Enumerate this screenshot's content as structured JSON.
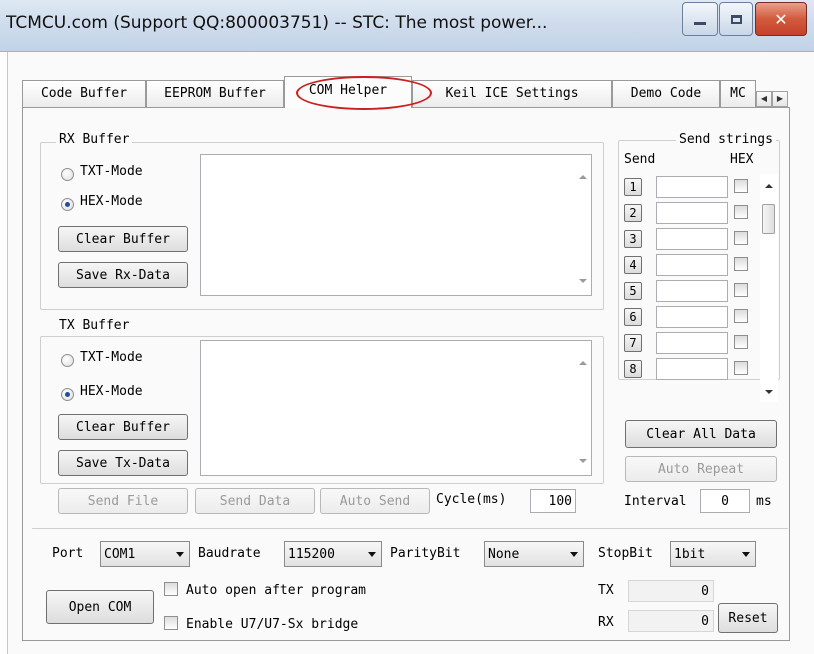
{
  "window": {
    "title": "TCMCU.com  (Support QQ:800003751)  -- STC: The most power..."
  },
  "tabs": [
    {
      "label": "Code Buffer"
    },
    {
      "label": "EEPROM Buffer"
    },
    {
      "label": "COM Helper",
      "active": true
    },
    {
      "label": "Keil ICE Settings"
    },
    {
      "label": "Demo Code"
    },
    {
      "label": "MC"
    }
  ],
  "rx": {
    "group_label": "RX Buffer",
    "txt_mode": "TXT-Mode",
    "hex_mode": "HEX-Mode",
    "selected_mode": "HEX-Mode",
    "clear_button": "Clear Buffer",
    "save_button": "Save Rx-Data",
    "content": ""
  },
  "tx": {
    "group_label": "TX Buffer",
    "txt_mode": "TXT-Mode",
    "hex_mode": "HEX-Mode",
    "selected_mode": "HEX-Mode",
    "clear_button": "Clear Buffer",
    "save_button": "Save Tx-Data",
    "content": ""
  },
  "actions": {
    "send_file": "Send File",
    "send_data": "Send Data",
    "auto_send": "Auto Send",
    "cycle_label": "Cycle(ms)",
    "cycle_value": "100"
  },
  "send_strings": {
    "group_label": "Send strings",
    "send_header": "Send",
    "hex_header": "HEX",
    "rows": [
      {
        "num": "1",
        "value": "",
        "hex": false
      },
      {
        "num": "2",
        "value": "",
        "hex": false
      },
      {
        "num": "3",
        "value": "",
        "hex": false
      },
      {
        "num": "4",
        "value": "",
        "hex": false
      },
      {
        "num": "5",
        "value": "",
        "hex": false
      },
      {
        "num": "6",
        "value": "",
        "hex": false
      },
      {
        "num": "7",
        "value": "",
        "hex": false
      },
      {
        "num": "8",
        "value": "",
        "hex": false
      }
    ],
    "clear_all": "Clear All Data",
    "auto_repeat": "Auto Repeat",
    "interval_label": "Interval",
    "interval_value": "0",
    "interval_unit": "ms"
  },
  "port": {
    "port_label": "Port",
    "port_value": "COM1",
    "baud_label": "Baudrate",
    "baud_value": "115200",
    "parity_label": "ParityBit",
    "parity_value": "None",
    "stopbit_label": "StopBit",
    "stopbit_value": "1bit",
    "open_button": "Open COM",
    "auto_open": "Auto open after program",
    "bridge": "Enable U7/U7-Sx bridge",
    "tx_label": "TX",
    "tx_value": "0",
    "rx_label": "RX",
    "rx_value": "0",
    "reset_button": "Reset"
  },
  "colors": {
    "highlight": "#cc1f1f",
    "close_button": "#d25a3c"
  }
}
